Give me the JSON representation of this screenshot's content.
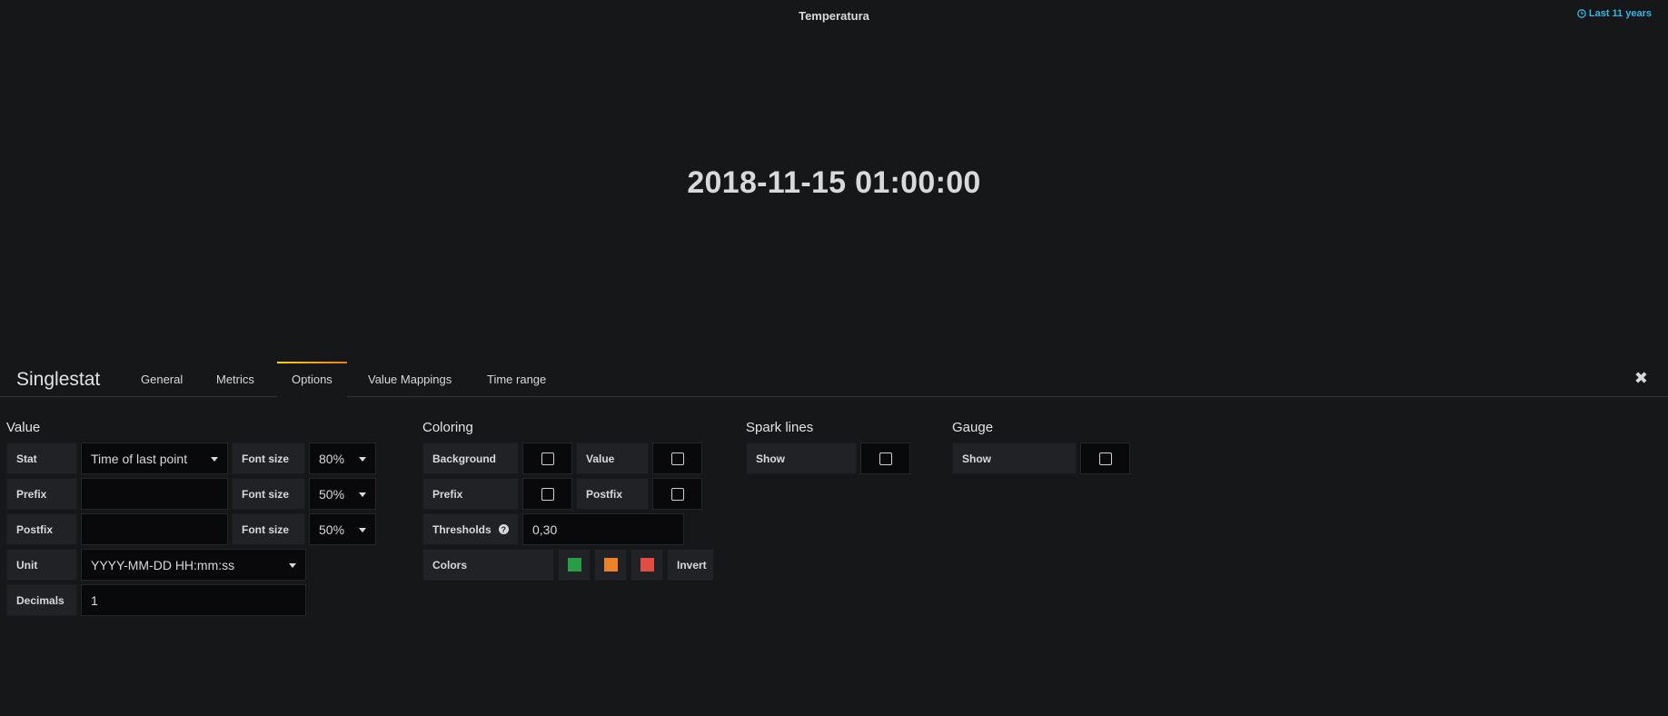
{
  "panel": {
    "title": "Temperatura",
    "time_info": "Last 11 years",
    "value": "2018-11-15 01:00:00"
  },
  "editor": {
    "title": "Singlestat",
    "tabs": [
      {
        "label": "General"
      },
      {
        "label": "Metrics"
      },
      {
        "label": "Options",
        "active": true
      },
      {
        "label": "Value Mappings"
      },
      {
        "label": "Time range"
      }
    ],
    "close_icon": "close-icon"
  },
  "value_section": {
    "title": "Value",
    "stat_label": "Stat",
    "stat_value": "Time of last point",
    "prefix_label": "Prefix",
    "prefix_value": "",
    "postfix_label": "Postfix",
    "postfix_value": "",
    "font_size_label": "Font size",
    "stat_font_size": "80%",
    "prefix_font_size": "50%",
    "postfix_font_size": "50%",
    "unit_label": "Unit",
    "unit_value": "YYYY-MM-DD HH:mm:ss",
    "decimals_label": "Decimals",
    "decimals_value": "1"
  },
  "coloring_section": {
    "title": "Coloring",
    "background_label": "Background",
    "value_label": "Value",
    "prefix_label": "Prefix",
    "postfix_label": "Postfix",
    "thresholds_label": "Thresholds",
    "thresholds_value": "0,30",
    "colors_label": "Colors",
    "colors": [
      "#299c46",
      "#ed8128",
      "#e24d42"
    ],
    "invert_label": "Invert"
  },
  "sparklines_section": {
    "title": "Spark lines",
    "show_label": "Show"
  },
  "gauge_section": {
    "title": "Gauge",
    "show_label": "Show"
  },
  "colors": {
    "accent_time": "#33b5e5",
    "tab_active_gradient": [
      "#ffd500",
      "#eb7b18"
    ]
  }
}
